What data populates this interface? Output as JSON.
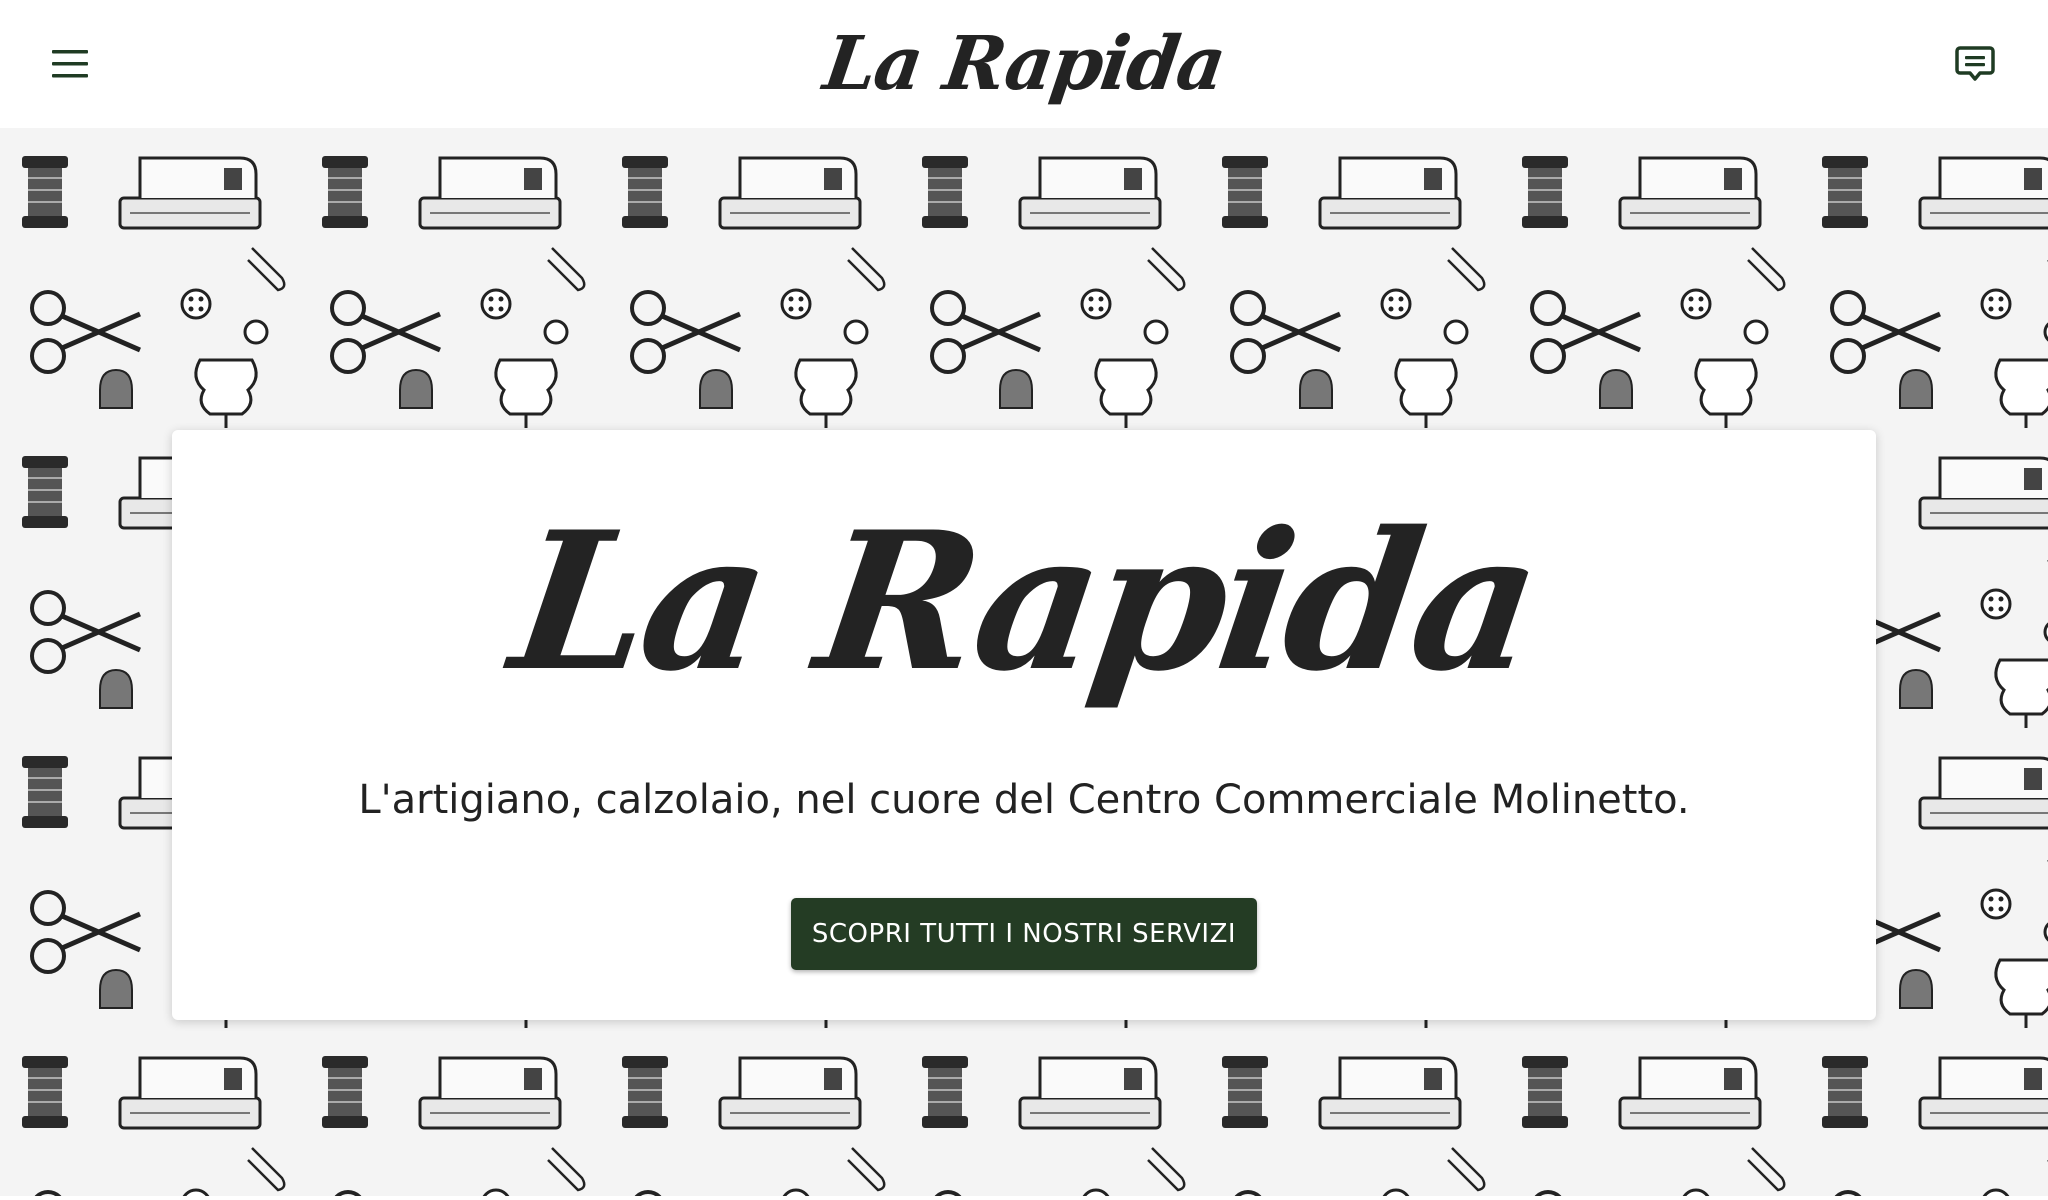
{
  "brand": {
    "logo_text": "La Rapida",
    "accent_color": "#243c24",
    "icon_color": "#1f3b23"
  },
  "header": {
    "menu_icon": "hamburger-menu-icon",
    "chat_icon": "chat-bubble-icon"
  },
  "hero": {
    "background_pattern": "sewing-tools-sketch-pattern",
    "title": "La Rapida",
    "tagline": "L'artigiano, calzolaio, nel cuore del Centro Commerciale Molinetto.",
    "cta_label": "SCOPRI TUTTI I NOSTRI SERVIZI"
  }
}
